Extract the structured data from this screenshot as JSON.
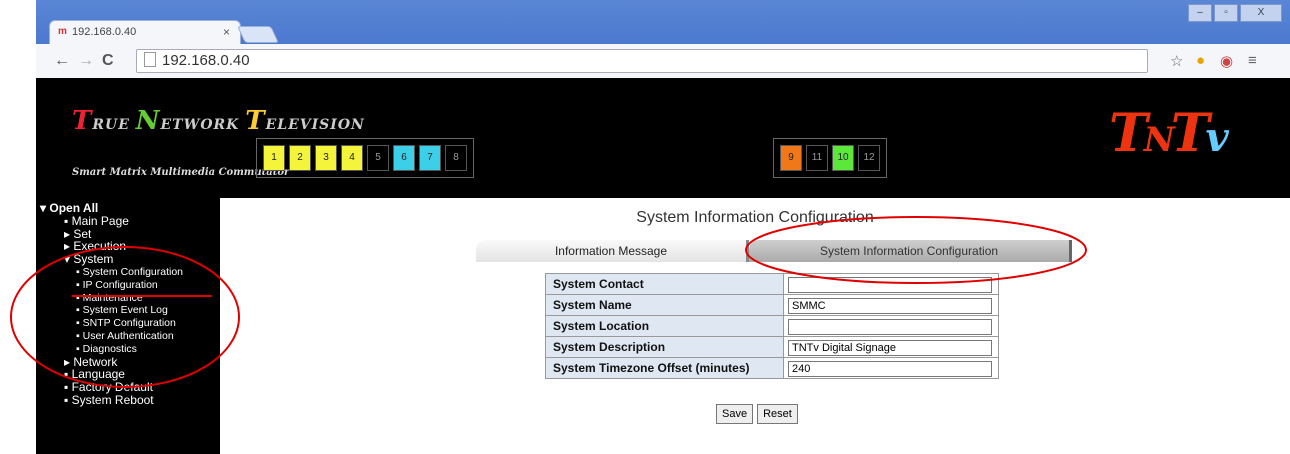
{
  "browser": {
    "tab_title": "192.168.0.40",
    "url": "192.168.0.40",
    "window_controls": [
      "–",
      "▫",
      "X"
    ]
  },
  "header": {
    "brand": {
      "w1_first": "T",
      "w1_rest": "RUE",
      "w2_first": "N",
      "w2_rest": "ETWORK",
      "w3_first": "T",
      "w3_rest": "ELEVISION"
    },
    "tagline": "Smart Matrix Multimedia Commutator",
    "ports_group1": [
      {
        "label": "1",
        "color": "#f4f43a"
      },
      {
        "label": "2",
        "color": "#f4f43a"
      },
      {
        "label": "3",
        "color": "#f4f43a"
      },
      {
        "label": "4",
        "color": "#f4f43a"
      },
      {
        "label": "5",
        "color": "#000000"
      },
      {
        "label": "6",
        "color": "#3cd0e8"
      },
      {
        "label": "7",
        "color": "#3cd0e8"
      },
      {
        "label": "8",
        "color": "#000000"
      }
    ],
    "ports_group2": [
      {
        "label": "9",
        "color": "#f07818"
      },
      {
        "label": "11",
        "color": "#000000"
      },
      {
        "label": "10",
        "color": "#5ce83a"
      },
      {
        "label": "12",
        "color": "#000000"
      }
    ],
    "logo": "TNTv"
  },
  "sidebar": {
    "open_all": "▾ Open All",
    "items": [
      {
        "label": "▪ Main Page",
        "level": 1
      },
      {
        "label": "▸ Set",
        "level": 1
      },
      {
        "label": "▸ Execution",
        "level": 1
      },
      {
        "label": "▾ System",
        "level": 1
      },
      {
        "label": "▪ System Configuration",
        "level": 2
      },
      {
        "label": "▪ IP Configuration",
        "level": 2
      },
      {
        "label": "▪ Maintenance",
        "level": 2
      },
      {
        "label": "▪ System Event Log",
        "level": 2
      },
      {
        "label": "▪ SNTP Configuration",
        "level": 2
      },
      {
        "label": "▪ User Authentication",
        "level": 2
      },
      {
        "label": "▪ Diagnostics",
        "level": 2
      },
      {
        "label": "▸ Network",
        "level": 1
      },
      {
        "label": "▪ Language",
        "level": 1
      },
      {
        "label": "▪ Factory Default",
        "level": 1
      },
      {
        "label": "▪ System Reboot",
        "level": 1
      }
    ]
  },
  "main": {
    "title": "System Information Configuration",
    "tabs": [
      "Information Message",
      "System Information Configuration"
    ],
    "fields": [
      {
        "label": "System Contact",
        "value": ""
      },
      {
        "label": "System Name",
        "value": "SMMC"
      },
      {
        "label": "System Location",
        "value": ""
      },
      {
        "label": "System Description",
        "value": "TNTv Digital Signage"
      },
      {
        "label": "System Timezone Offset (minutes)",
        "value": "240"
      }
    ],
    "save_label": "Save",
    "reset_label": "Reset"
  },
  "colors": {
    "annotation": "#e00000",
    "label_bg": "#dfe7f2"
  }
}
